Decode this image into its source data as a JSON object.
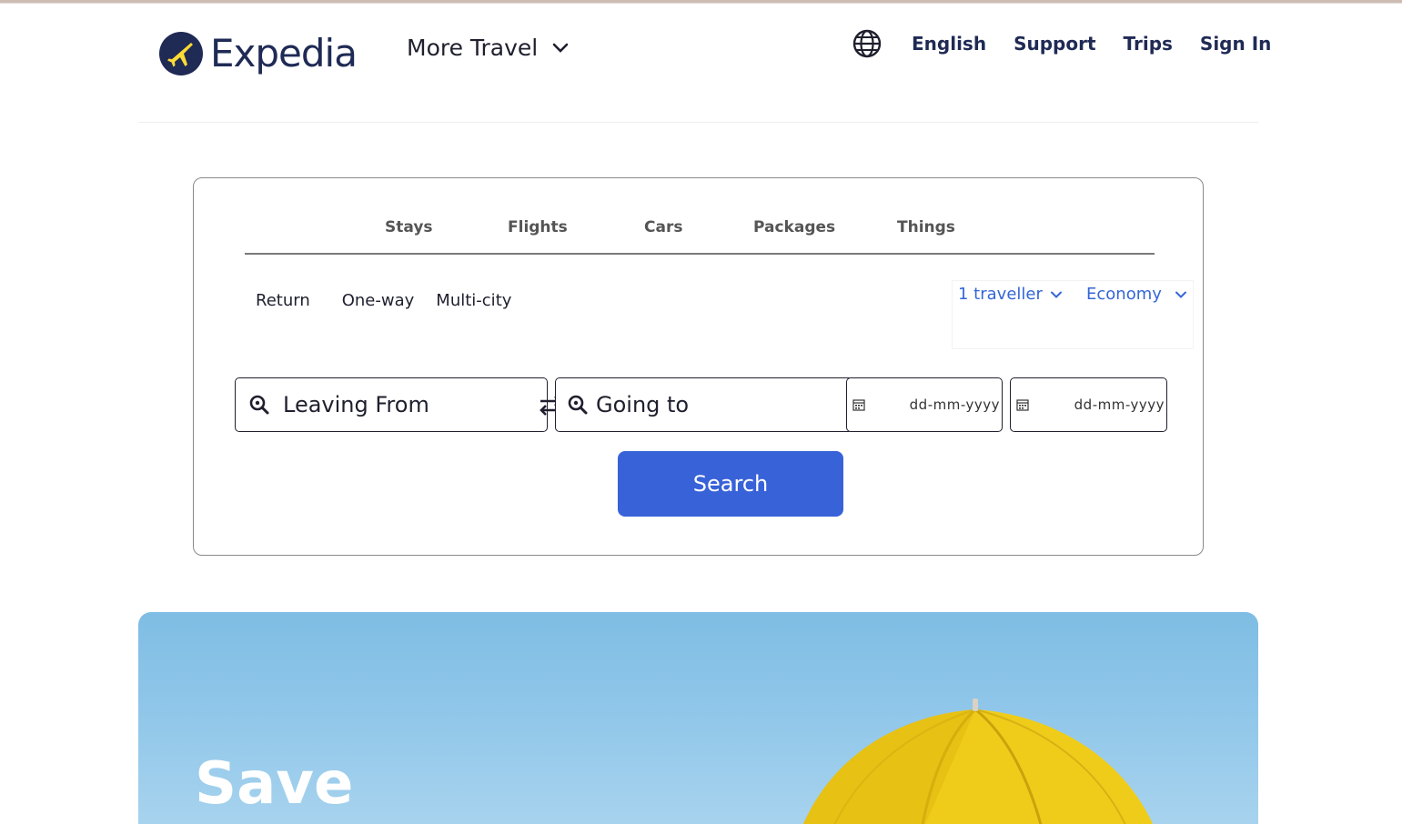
{
  "header": {
    "brand": "Expedia",
    "more_travel": "More Travel",
    "language": "English",
    "support": "Support",
    "trips": "Trips",
    "sign_in": "Sign In"
  },
  "search": {
    "tabs": [
      "Stays",
      "Flights",
      "Cars",
      "Packages",
      "Things"
    ],
    "trip_types": [
      "Return",
      "One-way",
      "Multi-city"
    ],
    "travellers": "1 traveller",
    "cabin_class": "Economy",
    "leaving_from": "Leaving From",
    "going_to": "Going to",
    "depart_placeholder": "dd-mm-yyyy",
    "return_placeholder": "dd-mm-yyyy",
    "search_button": "Search"
  },
  "hero": {
    "title": "Save"
  },
  "colors": {
    "brand_navy": "#1f2a55",
    "brand_yellow": "#fddb32",
    "accent_blue": "#3862d8",
    "link_blue": "#3466d6",
    "hero_sky": "#8fc6e9",
    "umbrella_yellow": "#f0cc1a"
  },
  "icons": [
    "expedia-logo-icon",
    "chevron-down-icon",
    "globe-icon",
    "search-icon",
    "swap-icon",
    "calendar-icon"
  ]
}
